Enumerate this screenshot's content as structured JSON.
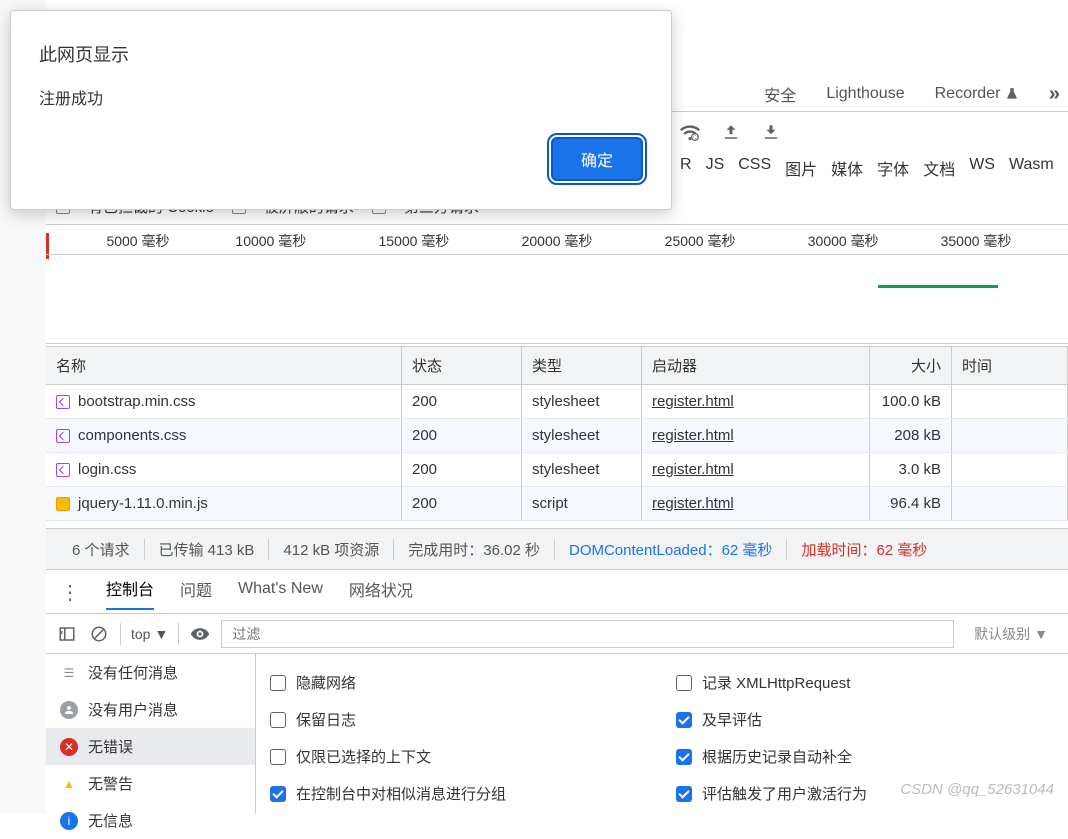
{
  "dialog": {
    "title": "此网页显示",
    "message": "注册成功",
    "ok": "确定"
  },
  "top_tabs": {
    "t1": "安全",
    "t2": "Lighthouse",
    "t3": "Recorder"
  },
  "filters": {
    "r": "R",
    "js": "JS",
    "css": "CSS",
    "img": "图片",
    "media": "媒体",
    "font": "字体",
    "doc": "文档",
    "ws": "WS",
    "wasm": "Wasm"
  },
  "cookie_row": {
    "c1": "有已拦截的 Cookie",
    "c2": "被屏蔽的请求",
    "c3": "第三方请求"
  },
  "timeline": {
    "t1": "5000 毫秒",
    "t2": "10000 毫秒",
    "t3": "15000 毫秒",
    "t4": "20000 毫秒",
    "t5": "25000 毫秒",
    "t6": "30000 毫秒",
    "t7": "35000 毫秒"
  },
  "table": {
    "headers": {
      "name": "名称",
      "status": "状态",
      "type": "类型",
      "initiator": "启动器",
      "size": "大小",
      "time": "时间"
    },
    "rows": [
      {
        "name": "bootstrap.min.css",
        "status": "200",
        "type": "stylesheet",
        "initiator": "register.html",
        "size": "100.0 kB",
        "icon": "css"
      },
      {
        "name": "components.css",
        "status": "200",
        "type": "stylesheet",
        "initiator": "register.html",
        "size": "208 kB",
        "icon": "css"
      },
      {
        "name": "login.css",
        "status": "200",
        "type": "stylesheet",
        "initiator": "register.html",
        "size": "3.0 kB",
        "icon": "css"
      },
      {
        "name": "jquery-1.11.0.min.js",
        "status": "200",
        "type": "script",
        "initiator": "register.html",
        "size": "96.4 kB",
        "icon": "js"
      }
    ]
  },
  "status": {
    "requests": "6 个请求",
    "transferred": "已传输 413 kB",
    "resources": "412 kB 项资源",
    "finish": "完成用时：36.02 秒",
    "dom": "DOMContentLoaded：62 毫秒",
    "load": "加载时间：62 毫秒"
  },
  "console_tabs": {
    "console": "控制台",
    "issues": "问题",
    "whatsnew": "What's New",
    "network": "网络状况"
  },
  "console_filter": {
    "top": "top",
    "placeholder": "过滤",
    "level": "默认级别"
  },
  "sidebar": {
    "none": "没有任何消息",
    "user": "没有用户消息",
    "err": "无错误",
    "warn": "无警告",
    "info": "无信息"
  },
  "settings": {
    "hide_network": "隐藏网络",
    "preserve_log": "保留日志",
    "selected_context": "仅限已选择的上下文",
    "group_similar": "在控制台中对相似消息进行分组",
    "log_xhr": "记录 XMLHttpRequest",
    "eager_eval": "及早评估",
    "autocomplete": "根据历史记录自动补全",
    "user_activation": "评估触发了用户激活行为"
  },
  "watermark": "CSDN @qq_52631044"
}
